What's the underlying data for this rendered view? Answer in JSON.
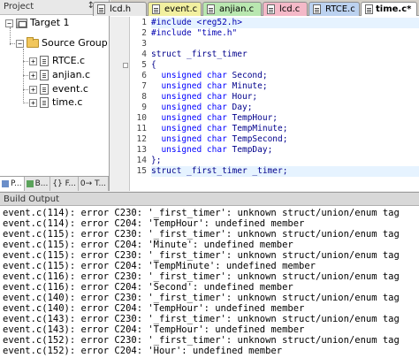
{
  "project_panel": {
    "title": "Project",
    "pin_glyph": "↕",
    "close_glyph": "×",
    "tree": {
      "target": "Target 1",
      "group": "Source Group 1",
      "files": [
        "RTCE.c",
        "anjian.c",
        "event.c",
        "time.c"
      ]
    },
    "tabs": [
      "P...",
      "B...",
      "{} F...",
      "0→ T..."
    ]
  },
  "editor": {
    "tabs": [
      {
        "label": "lcd.h",
        "color": "#e8e8e8"
      },
      {
        "label": "event.c",
        "color": "#f2f0a0"
      },
      {
        "label": "anjian.c",
        "color": "#b9e7b0"
      },
      {
        "label": "lcd.c",
        "color": "#f4b9c8"
      },
      {
        "label": "RTCE.c",
        "color": "#bcd2f0"
      },
      {
        "label": "time.c*",
        "color": "#f2f0a0"
      }
    ],
    "line_numbers": [
      "1",
      "2",
      "3",
      "4",
      "5",
      "6",
      "7",
      "8",
      "9",
      "10",
      "11",
      "12",
      "13",
      "14",
      "15"
    ],
    "lines": [
      [
        "#include <reg52.h>"
      ],
      [
        "#include \"time.h\""
      ],
      [
        ""
      ],
      [
        "struct _first_timer"
      ],
      [
        "{"
      ],
      [
        "  ",
        "unsigned char",
        " Second;"
      ],
      [
        "  ",
        "unsigned char",
        " Minute;"
      ],
      [
        "  ",
        "unsigned char",
        " Hour;"
      ],
      [
        "  ",
        "unsigned char",
        " Day;"
      ],
      [
        "  ",
        "unsigned char",
        " TempHour;"
      ],
      [
        "  ",
        "unsigned char",
        " TempMinute;"
      ],
      [
        "  ",
        "unsigned char",
        " TempSecond;"
      ],
      [
        "  ",
        "unsigned char",
        " TempDay;"
      ],
      [
        "};"
      ],
      [
        "struct _first_timer _timer;"
      ]
    ]
  },
  "build_output": {
    "title": "Build Output",
    "lines": [
      "event.c(114): error C230: '_first_timer': unknown struct/union/enum tag",
      "event.c(114): error C204: 'TempHour': undefined member",
      "event.c(115): error C230: '_first_timer': unknown struct/union/enum tag",
      "event.c(115): error C204: 'Minute': undefined member",
      "event.c(115): error C230: '_first_timer': unknown struct/union/enum tag",
      "event.c(115): error C204: 'TempMinute': undefined member",
      "event.c(116): error C230: '_first_timer': unknown struct/union/enum tag",
      "event.c(116): error C204: 'Second': undefined member",
      "event.c(140): error C230: '_first_timer': unknown struct/union/enum tag",
      "event.c(140): error C204: 'TempHour': undefined member",
      "event.c(143): error C230: '_first_timer': unknown struct/union/enum tag",
      "event.c(143): error C204: 'TempHour': undefined member",
      "event.c(152): error C230: '_first_timer': unknown struct/union/enum tag",
      "event.c(152): error C204: 'Hour': undefined member"
    ]
  }
}
